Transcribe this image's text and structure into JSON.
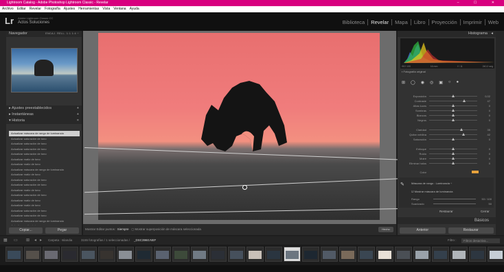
{
  "window": {
    "title": "Lightroom Catalog - Adobe Photoshop Lightroom Classic - Revelar",
    "controls": "– ☐ ✕"
  },
  "menu": [
    "Archivo",
    "Editar",
    "Revelar",
    "Fotografía",
    "Ajustes",
    "Herramientas",
    "Vista",
    "Ventana",
    "Ayuda"
  ],
  "identity": {
    "logo": "Lr",
    "product": "Adobe Lightroom Classic CC",
    "name": "Actos Soluciones"
  },
  "modules": [
    {
      "label": "Biblioteca",
      "active": false
    },
    {
      "label": "Revelar",
      "active": true
    },
    {
      "label": "Mapa",
      "active": false
    },
    {
      "label": "Libro",
      "active": false
    },
    {
      "label": "Proyección",
      "active": false
    },
    {
      "label": "Imprimir",
      "active": false
    },
    {
      "label": "Web",
      "active": false
    }
  ],
  "left": {
    "navigator": "Navegador",
    "nav_zoom": "ENCAJ.  RELL.  1:1  1:4 ÷",
    "presets": "Ajustes preestablecidos",
    "snapshots": "Instantáneas",
    "history": "Historia",
    "history_items": [
      "Actualizar máscara de rango de luminancia",
      "Actualizar saturación de tono",
      "Actualizar saturación de tono",
      "Actualizar saturación de tono",
      "Actualizar saturación de tono",
      "Actualizar matiz de tono",
      "Actualizar matiz de tono",
      "Actualizar máscara de rango de luminancia",
      "Actualizar matiz de tono",
      "Actualizar saturación de tono",
      "Actualizar saturación de tono",
      "Actualizar matiz de tono",
      "Actualizar saturación de tono",
      "Actualizar matiz de tono",
      "Actualizar matiz de tono",
      "Actualizar saturación de tono",
      "Actualizar saturación de tono",
      "Actualizar máscara de rango de luminancia",
      "Actualizar matiz de tono",
      "Actualizar ajuste de claridad",
      "Actualizar ajuste de contraste"
    ],
    "copy": "Copiar...",
    "paste": "Pegar"
  },
  "toolbar": {
    "show_pins": "Mostrar Editar puntos :",
    "pins_value": "Siempre",
    "overlay": "Mostrar superposición de máscara seleccionada",
    "done": "Hecho"
  },
  "right": {
    "histogram": "Histograma",
    "hist_info": [
      "ISO 100",
      "16 mm",
      "f / 11",
      "240,0 seg"
    ],
    "original": "Fotografía original",
    "sliders": [
      {
        "label": "Exposición",
        "value": "0,02",
        "pos": 0.5
      },
      {
        "label": "Contraste",
        "value": "47",
        "pos": 0.73
      },
      {
        "label": "Altas luces",
        "value": "0",
        "pos": 0.5
      },
      {
        "label": "Sombras",
        "value": "0",
        "pos": 0.5
      },
      {
        "label": "Blancos",
        "value": "0",
        "pos": 0.5
      },
      {
        "label": "Negros",
        "value": "0",
        "pos": 0.5
      },
      {
        "label": "Claridad",
        "value": "35",
        "pos": 0.67
      },
      {
        "label": "Quitar neblina",
        "value": "42",
        "pos": 0.71
      },
      {
        "label": "Saturación",
        "value": "0",
        "pos": 0.5
      },
      {
        "label": "Enfoque",
        "value": "0",
        "pos": 0.5
      },
      {
        "label": "Ruido",
        "value": "0",
        "pos": 0.5
      },
      {
        "label": "Moiré",
        "value": "0",
        "pos": 0.5
      },
      {
        "label": "Eliminar halos",
        "value": "0",
        "pos": 0.5
      }
    ],
    "color_label": "Color",
    "color_swatch": "#e7a23c",
    "mask_label": "Máscara de rango : Luminancia ÷",
    "mask_show": "Mostrar máscara de luminancia",
    "range_label": "Rango",
    "range_value": "53 / 100",
    "smooth_label": "Suavizado",
    "smooth_value": "50",
    "reset": "Restaurar",
    "close": "Cerrar",
    "basicos": "Básicos",
    "previous": "Anterior",
    "restore": "Restaurar"
  },
  "filmbar": {
    "folder": "Carpeta : Islandia",
    "count": "3155 fotografías / 1 seleccionadas /",
    "file": "_DSC3960.NEF",
    "filter": "Filtro :",
    "filter_value": "Filtros desactiva..."
  },
  "colors": {
    "titlebar": "#d8007f",
    "accent_sky": "#f07c7c"
  }
}
